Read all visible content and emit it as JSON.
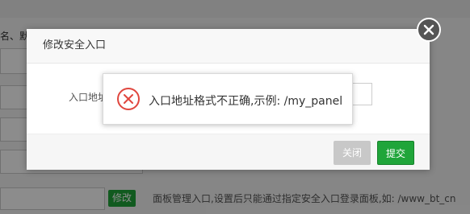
{
  "background": {
    "top_text": "名、默",
    "edit_button": "修改",
    "hint": "面板管理入口,设置后只能通过指定安全入口登录面板,如: /www_bt_cn"
  },
  "dialog": {
    "title": "修改安全入口",
    "field_label": "入口地址",
    "field_value": "",
    "close_button": "关闭",
    "submit_button": "提交"
  },
  "toast": {
    "message": "入口地址格式不正确,示例: /my_panel",
    "icon": "error-x-icon"
  },
  "colors": {
    "accent": "#20a53a",
    "error": "#e0463e",
    "disabled": "#c8c8c8"
  }
}
